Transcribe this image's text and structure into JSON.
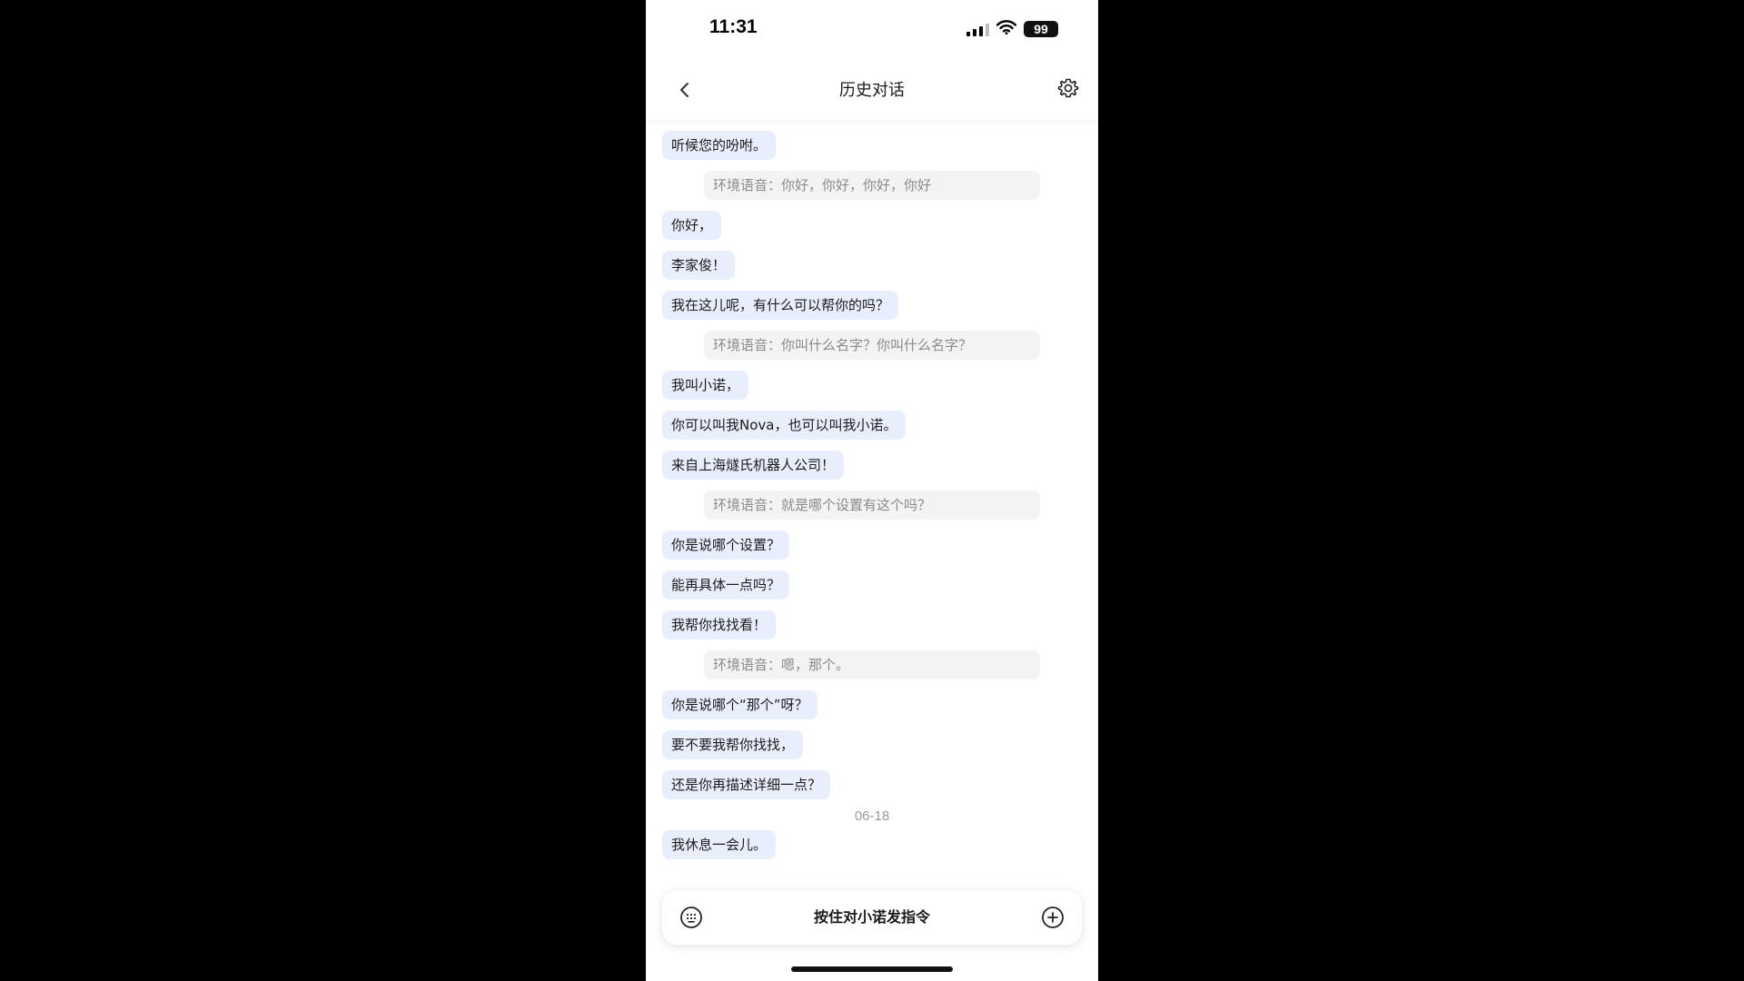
{
  "status_bar": {
    "time": "11:31",
    "battery": "99",
    "icons": [
      "signal-icon",
      "wifi-icon",
      "battery-icon"
    ]
  },
  "header": {
    "title": "历史对话",
    "back_icon": "chevron-left-icon",
    "settings_icon": "gear-icon"
  },
  "messages": [
    {
      "type": "reply",
      "text": "听候您的吩咐。"
    },
    {
      "type": "ambient",
      "text": "环境语音：你好，你好，你好，你好"
    },
    {
      "type": "reply",
      "text": "你好，"
    },
    {
      "type": "reply",
      "text": "李家俊！"
    },
    {
      "type": "reply",
      "text": "我在这儿呢，有什么可以帮你的吗？"
    },
    {
      "type": "ambient",
      "text": "环境语音：你叫什么名字？你叫什么名字？"
    },
    {
      "type": "reply",
      "text": "我叫小诺，"
    },
    {
      "type": "reply",
      "text": "你可以叫我Nova，也可以叫我小诺。"
    },
    {
      "type": "reply",
      "text": "来自上海燧氏机器人公司！"
    },
    {
      "type": "ambient",
      "text": "环境语音：就是哪个设置有这个吗？"
    },
    {
      "type": "reply",
      "text": "你是说哪个设置？"
    },
    {
      "type": "reply",
      "text": "能再具体一点吗？"
    },
    {
      "type": "reply",
      "text": "我帮你找找看！"
    },
    {
      "type": "ambient",
      "text": "环境语音：嗯，那个。"
    },
    {
      "type": "reply",
      "text": "你是说哪个“那个”呀？"
    },
    {
      "type": "reply",
      "text": "要不要我帮你找找，"
    },
    {
      "type": "reply",
      "text": "还是你再描述详细一点？"
    },
    {
      "type": "date",
      "text": "06-18"
    },
    {
      "type": "reply",
      "text": "我休息一会儿。"
    }
  ],
  "input_bar": {
    "hold_to_talk": "按住对小诺发指令",
    "keyboard_icon": "keyboard-icon",
    "add_icon": "plus-circle-icon"
  },
  "colors": {
    "reply_bubble": "#e9eefc",
    "ambient_bubble": "#f3f3f5",
    "ambient_text": "#8a8a8a",
    "background": "#ffffff",
    "letterbox": "#000000"
  }
}
